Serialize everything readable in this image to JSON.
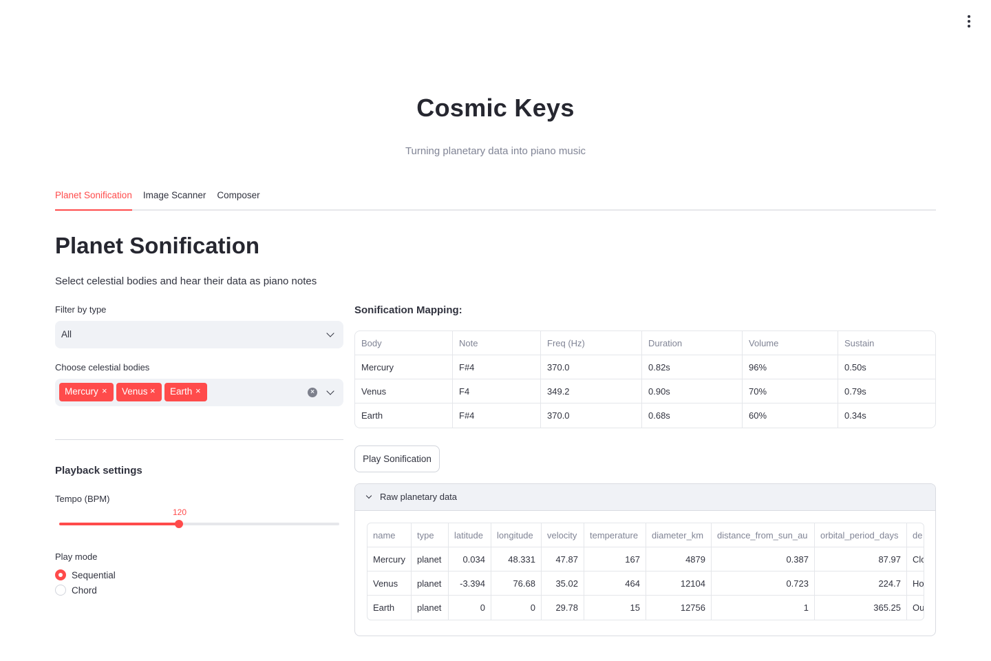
{
  "app": {
    "title": "Cosmic Keys",
    "subtitle": "Turning planetary data into piano music"
  },
  "tabs": [
    {
      "label": "Planet Sonification",
      "active": true
    },
    {
      "label": "Image Scanner",
      "active": false
    },
    {
      "label": "Composer",
      "active": false
    }
  ],
  "page": {
    "title": "Planet Sonification",
    "description": "Select celestial bodies and hear their data as piano notes"
  },
  "filter": {
    "label": "Filter by type",
    "value": "All"
  },
  "bodies": {
    "label": "Choose celestial bodies",
    "selected": [
      "Mercury",
      "Venus",
      "Earth"
    ],
    "remove_glyph": "×",
    "clear_glyph": "×"
  },
  "playback": {
    "heading": "Playback settings",
    "tempo_label": "Tempo (BPM)",
    "tempo_value": 120,
    "tempo_fraction": 0.427,
    "mode_label": "Play mode",
    "modes": [
      {
        "label": "Sequential",
        "selected": true
      },
      {
        "label": "Chord",
        "selected": false
      }
    ]
  },
  "mapping": {
    "heading": "Sonification Mapping:",
    "columns": [
      "Body",
      "Note",
      "Freq (Hz)",
      "Duration",
      "Volume",
      "Sustain"
    ],
    "rows": [
      [
        "Mercury",
        "F#4",
        "370.0",
        "0.82s",
        "96%",
        "0.50s"
      ],
      [
        "Venus",
        "F4",
        "349.2",
        "0.90s",
        "70%",
        "0.79s"
      ],
      [
        "Earth",
        "F#4",
        "370.0",
        "0.68s",
        "60%",
        "0.34s"
      ]
    ]
  },
  "play_button": "Play Sonification",
  "raw": {
    "title": "Raw planetary data",
    "columns": [
      "name",
      "type",
      "latitude",
      "longitude",
      "velocity",
      "temperature",
      "diameter_km",
      "distance_from_sun_au",
      "orbital_period_days",
      "de"
    ],
    "rows": [
      [
        "Mercury",
        "planet",
        "0.034",
        "48.331",
        "47.87",
        "167",
        "4879",
        "0.387",
        "87.97",
        "Clo"
      ],
      [
        "Venus",
        "planet",
        "-3.394",
        "76.68",
        "35.02",
        "464",
        "12104",
        "0.723",
        "224.7",
        "Ho"
      ],
      [
        "Earth",
        "planet",
        "0",
        "0",
        "29.78",
        "15",
        "12756",
        "1",
        "365.25",
        "Ou"
      ]
    ]
  },
  "colors": {
    "accent": "#ff4b4b",
    "text": "#31333f",
    "muted": "#808495",
    "input_bg": "#f0f2f6"
  },
  "icons": {
    "main_menu": "vertical-ellipsis-icon",
    "select_chevron": "chevron-down-icon",
    "expander_chevron": "chevron-down-icon",
    "clear": "clear-circle-icon"
  }
}
